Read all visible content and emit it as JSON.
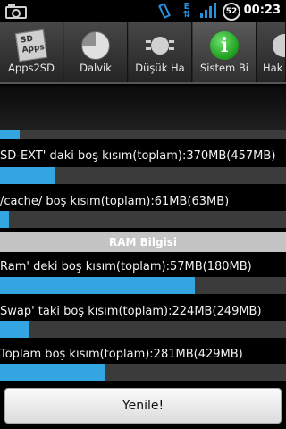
{
  "status_bar": {
    "time": "00:23",
    "battery": "52",
    "data_indicator": "E",
    "icons": [
      "camera-icon",
      "vibrate-icon",
      "edge-data-icon",
      "signal-icon",
      "battery-icon"
    ]
  },
  "tabs": [
    {
      "label": "Apps2SD",
      "icon": "sd-apps-icon"
    },
    {
      "label": "Dalvik",
      "icon": "pie-chart-icon"
    },
    {
      "label": "Düşük Ha",
      "icon": "chip-icon"
    },
    {
      "label": "Sistem Bi",
      "icon": "info-icon",
      "active": true
    },
    {
      "label": "Hak",
      "icon": "partial-icon"
    }
  ],
  "storage": {
    "top_bar_fill": 0.07,
    "sd_ext": {
      "text": "SD-EXT' daki boş kısım(toplam):370MB(457MB)",
      "fill": 0.19
    },
    "cache": {
      "text": "/cache/ boş kısım(toplam):61MB(63MB)",
      "fill": 0.03
    }
  },
  "ram": {
    "header": "RAM Bilgisi",
    "ram": {
      "text": "Ram' deki boş kısım(toplam):57MB(180MB)",
      "fill": 0.68
    },
    "swap": {
      "text": "Swap' taki boş kısım(toplam):224MB(249MB)",
      "fill": 0.1
    },
    "total": {
      "text": "Toplam boş kısım(toplam):281MB(429MB)",
      "fill": 0.37
    }
  },
  "refresh_button": "Yenile!",
  "colors": {
    "accent": "#33a6e1",
    "status_blue": "#2a8fd9",
    "info_green": "#1b9c1b"
  }
}
